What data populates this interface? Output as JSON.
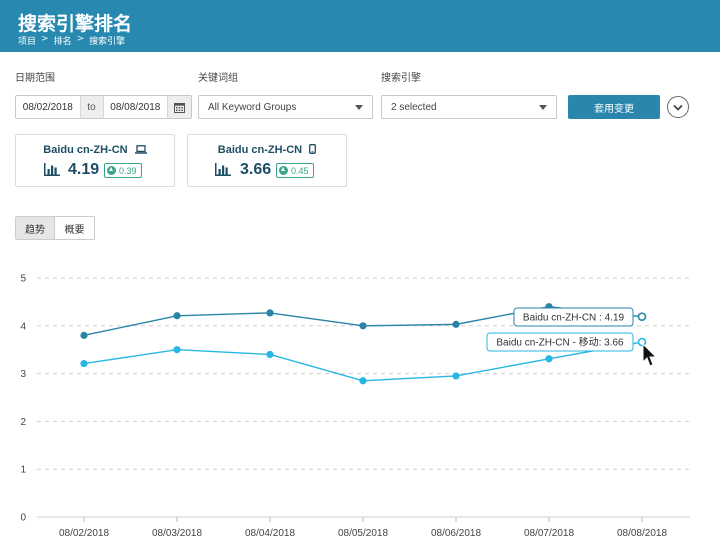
{
  "header": {
    "title": "搜索引擎排名",
    "breadcrumb": [
      "项目",
      "排名",
      "搜索引擎"
    ],
    "breadcrumb_sep": ">"
  },
  "filters": {
    "date_label": "日期范围",
    "date_from": "08/02/2018",
    "date_to_word": "to",
    "date_to": "08/08/2018",
    "keyword_label": "关键词组",
    "keyword_value": "All Keyword Groups",
    "engine_label": "搜索引擎",
    "engine_value": "2 selected",
    "apply_label": "套用变更"
  },
  "cards": [
    {
      "title": "Baidu cn-ZH-CN",
      "device_icon": "laptop-icon",
      "value": "4.19",
      "change": "0.39"
    },
    {
      "title": "Baidu cn-ZH-CN",
      "device_icon": "mobile-icon",
      "value": "3.66",
      "change": "0.45"
    }
  ],
  "tabs": [
    {
      "label": "趋势",
      "active": true
    },
    {
      "label": "概要",
      "active": false
    }
  ],
  "colors": {
    "header": "#2889b0",
    "series_desktop": "#2a84a8",
    "series_mobile": "#27b7e3",
    "badge_green": "#3aa58a",
    "text_dark": "#1d4e63"
  },
  "chart_data": {
    "type": "line",
    "x": [
      "08/02/2018",
      "08/03/2018",
      "08/04/2018",
      "08/05/2018",
      "08/06/2018",
      "08/07/2018",
      "08/08/2018"
    ],
    "ylim": [
      0,
      5
    ],
    "yticks": [
      0,
      1,
      2,
      3,
      4,
      5
    ],
    "grid": true,
    "series": [
      {
        "name": "Baidu cn-ZH-CN",
        "values": [
          3.8,
          4.21,
          4.27,
          4.0,
          4.03,
          4.4,
          4.19
        ],
        "color": "#2a84a8"
      },
      {
        "name": "Baidu cn-ZH-CN - 移动",
        "values": [
          3.21,
          3.5,
          3.4,
          2.85,
          2.95,
          3.31,
          3.66
        ],
        "color": "#27b7e3"
      }
    ],
    "tooltips": [
      {
        "text": "Baidu cn-ZH-CN : 4.19"
      },
      {
        "text": "Baidu cn-ZH-CN - 移动: 3.66"
      }
    ]
  }
}
